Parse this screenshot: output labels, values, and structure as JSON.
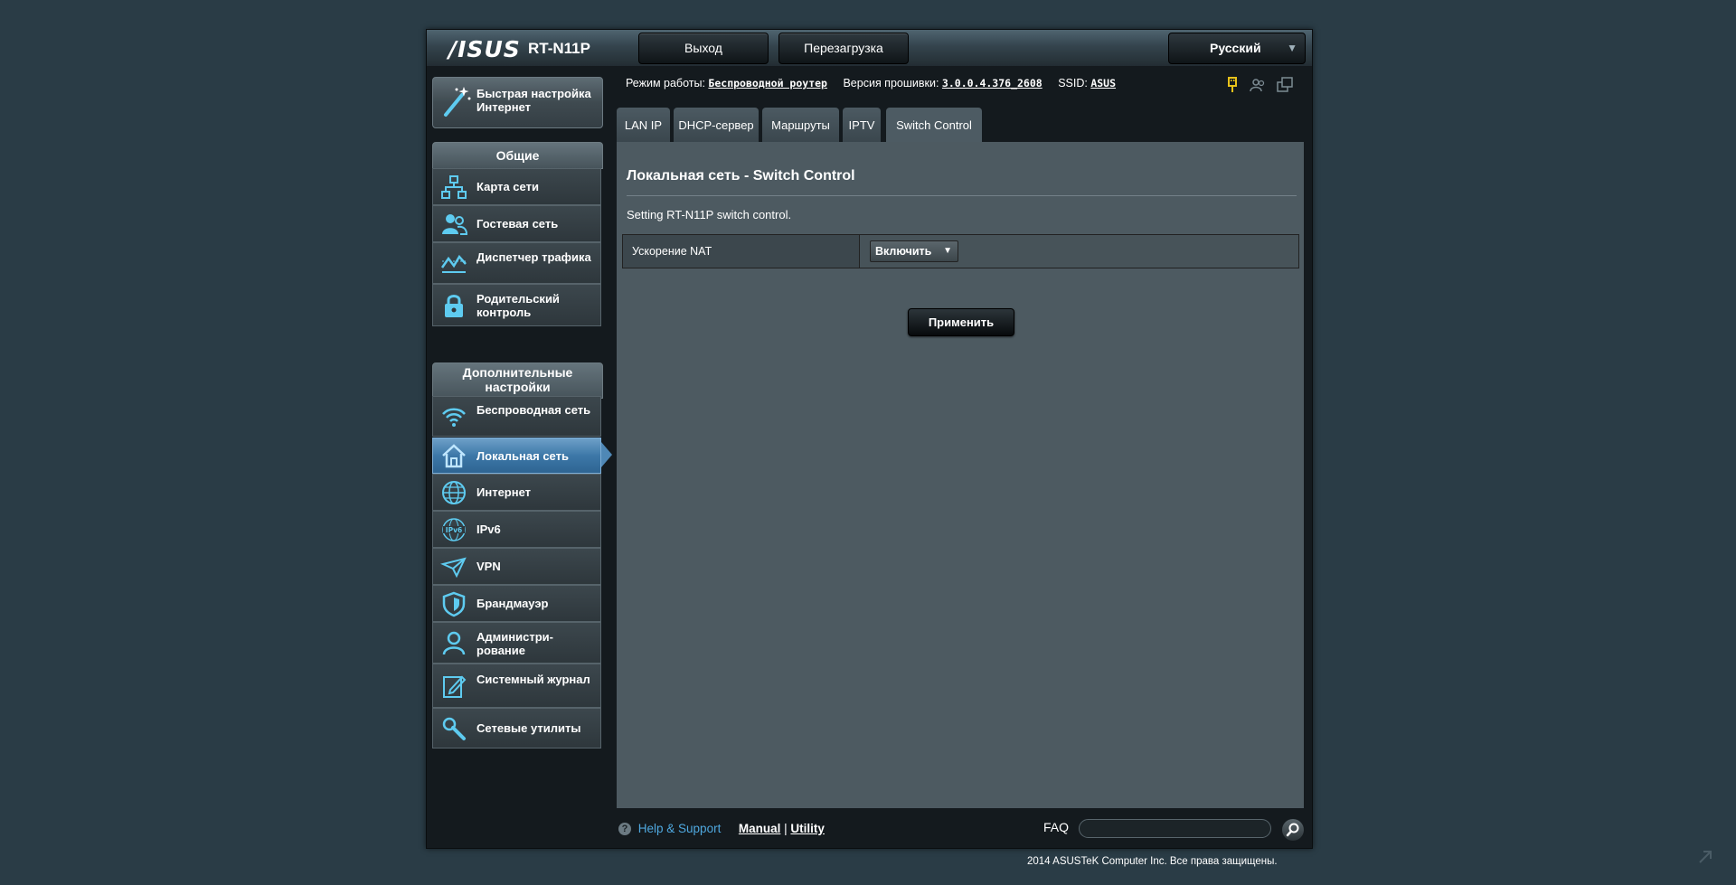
{
  "header": {
    "brand": "/ISUS",
    "model": "RT-N11P",
    "logout_label": "Выход",
    "reboot_label": "Перезагрузка",
    "language": "Русский"
  },
  "sidebar": {
    "quick_setup": "Быстрая настройка Интернет",
    "general_title": "Общие",
    "general_items": [
      {
        "label": "Карта сети",
        "icon": "network-map-icon"
      },
      {
        "label": "Гостевая сеть",
        "icon": "guest-network-icon"
      },
      {
        "label": "Диспетчер трафика",
        "icon": "traffic-manager-icon"
      },
      {
        "label": "Родительский контроль",
        "icon": "lock-icon"
      }
    ],
    "advanced_title": "Дополнительные настройки",
    "advanced_items": [
      {
        "label": "Беспроводная сеть",
        "icon": "wifi-icon"
      },
      {
        "label": "Локальная сеть",
        "icon": "home-icon",
        "active": true
      },
      {
        "label": "Интернет",
        "icon": "globe-icon"
      },
      {
        "label": "IPv6",
        "icon": "ipv6-icon"
      },
      {
        "label": "VPN",
        "icon": "vpn-icon"
      },
      {
        "label": "Брандмауэр",
        "icon": "shield-icon"
      },
      {
        "label": "Администри-рование",
        "icon": "user-icon"
      },
      {
        "label": "Системный журнал",
        "icon": "log-icon"
      },
      {
        "label": "Сетевые утилиты",
        "icon": "tools-icon"
      }
    ]
  },
  "status": {
    "mode_label": "Режим работы:",
    "mode_value": "Беспроводной роутер",
    "fw_label": "Версия прошивки:",
    "fw_value": "3.0.0.4.376_2608",
    "ssid_label": "SSID:",
    "ssid_value": "ASUS"
  },
  "tabs": [
    "LAN IP",
    "DHCP-сервер",
    "Маршруты",
    "IPTV",
    "Switch Control"
  ],
  "active_tab": "Switch Control",
  "content": {
    "title": "Локальная сеть - Switch Control",
    "description": "Setting RT-N11P switch control.",
    "nat_label": "Ускорение NAT",
    "nat_value": "Включить",
    "apply_label": "Применить"
  },
  "footer": {
    "help": "Help & Support",
    "manual": "Manual",
    "separator": "|",
    "utility": "Utility",
    "faq": "FAQ",
    "copyright": "2014  ASUSTeK Computer Inc. Все права защищены."
  },
  "colors": {
    "accent": "#4fa8df",
    "icon": "#5ecbf0",
    "active_menu": "#3d78a8",
    "status_yellow": "#e8c21a"
  }
}
